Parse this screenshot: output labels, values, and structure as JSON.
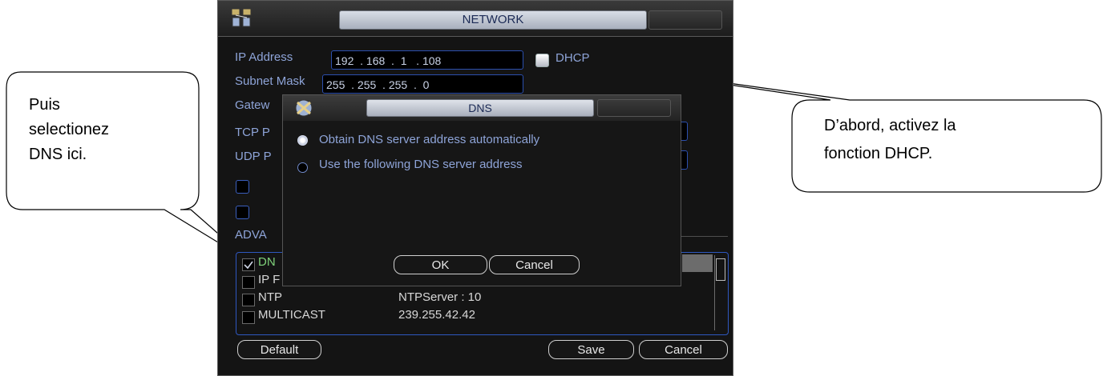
{
  "network_window": {
    "title": "NETWORK",
    "fields": {
      "ip_label": "IP Address",
      "ip_value": "192  . 168  .  1   . 108",
      "dhcp_label": "DHCP",
      "subnet_label": "Subnet Mask",
      "subnet_value": "255  . 255  . 255  .  0",
      "gateway_label": "Gatew",
      "tcp_label": "TCP P",
      "udp_label": "UDP P"
    },
    "advanced_label": "ADVA",
    "list_rows": [
      {
        "name": "DN",
        "value": "",
        "checked": true
      },
      {
        "name": "IP F",
        "value": "",
        "checked": false
      },
      {
        "name": "NTP",
        "value": "NTPServer : 10",
        "checked": false
      },
      {
        "name": "MULTICAST",
        "value": "239.255.42.42",
        "checked": false
      }
    ],
    "buttons": {
      "default": "Default",
      "save": "Save",
      "cancel": "Cancel"
    }
  },
  "dns_dialog": {
    "title": "DNS",
    "options": [
      {
        "label": "Obtain DNS server address automatically",
        "selected": true
      },
      {
        "label": "Use the following DNS server address",
        "selected": false
      }
    ],
    "buttons": {
      "ok": "OK",
      "cancel": "Cancel"
    }
  },
  "callouts": {
    "left": [
      "Puis",
      "selectionez",
      "DNS ici."
    ],
    "right": [
      "D’abord, activez la",
      "fonction DHCP."
    ]
  },
  "colors": {
    "label_blue": "#8ea4d8",
    "field_border": "#2b4fae",
    "title_text": "#1b2a55"
  }
}
